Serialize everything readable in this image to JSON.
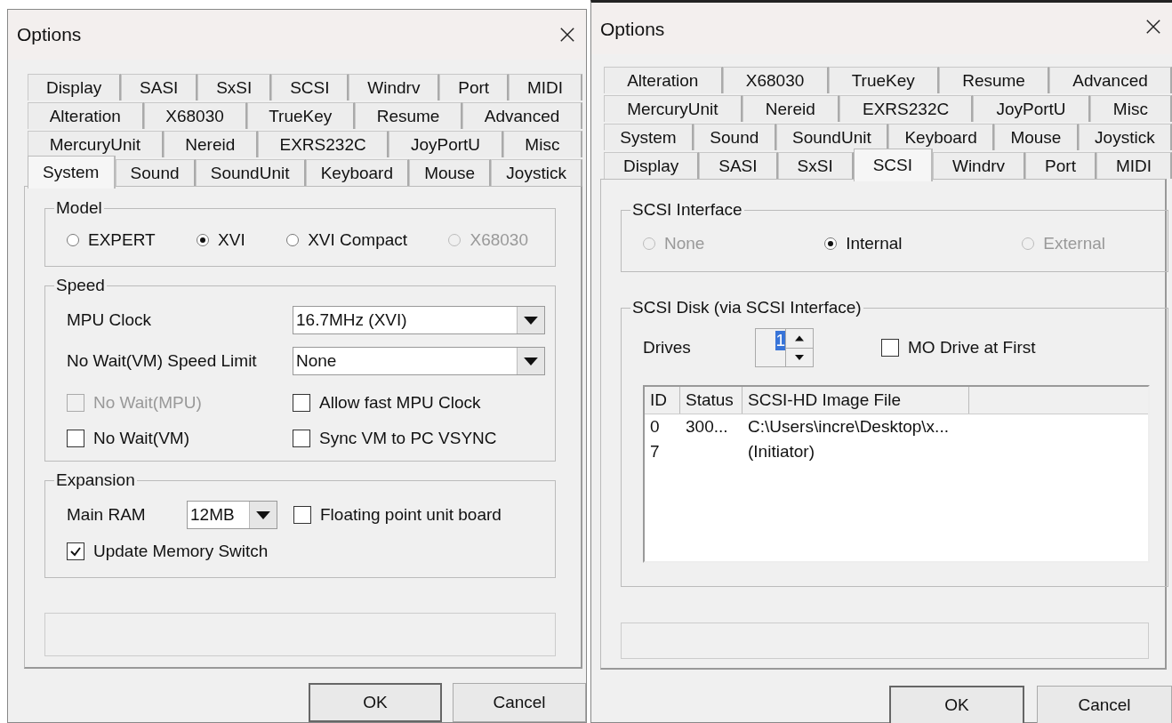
{
  "dialogs": [
    {
      "title": "Options",
      "tab_rows": [
        [
          {
            "label": "Display",
            "selected": false
          },
          {
            "label": "SASI",
            "selected": false
          },
          {
            "label": "SxSI",
            "selected": false
          },
          {
            "label": "SCSI",
            "selected": false
          },
          {
            "label": "Windrv",
            "selected": false
          },
          {
            "label": "Port",
            "selected": false
          },
          {
            "label": "MIDI",
            "selected": false
          }
        ],
        [
          {
            "label": "Alteration",
            "selected": false
          },
          {
            "label": "X68030",
            "selected": false
          },
          {
            "label": "TrueKey",
            "selected": false
          },
          {
            "label": "Resume",
            "selected": false
          },
          {
            "label": "Advanced",
            "selected": false
          }
        ],
        [
          {
            "label": "MercuryUnit",
            "selected": false
          },
          {
            "label": "Nereid",
            "selected": false
          },
          {
            "label": "EXRS232C",
            "selected": false
          },
          {
            "label": "JoyPortU",
            "selected": false
          },
          {
            "label": "Misc",
            "selected": false
          }
        ],
        [
          {
            "label": "System",
            "selected": true
          },
          {
            "label": "Sound",
            "selected": false
          },
          {
            "label": "SoundUnit",
            "selected": false
          },
          {
            "label": "Keyboard",
            "selected": false
          },
          {
            "label": "Mouse",
            "selected": false
          },
          {
            "label": "Joystick",
            "selected": false
          }
        ]
      ],
      "groups": [
        {
          "title": "Model",
          "controls": [
            {
              "kind": "radios",
              "options": [
                {
                  "label": "EXPERT",
                  "selected": false,
                  "disabled": false
                },
                {
                  "label": "XVI",
                  "selected": true,
                  "disabled": false
                },
                {
                  "label": "XVI Compact",
                  "selected": false,
                  "disabled": false
                },
                {
                  "label": "X68030",
                  "selected": false,
                  "disabled": true
                }
              ]
            }
          ]
        },
        {
          "title": "Speed",
          "controls": [
            {
              "kind": "select",
              "label": "MPU Clock",
              "value": "16.7MHz (XVI)"
            },
            {
              "kind": "select",
              "label": "No Wait(VM) Speed Limit",
              "value": "None"
            },
            {
              "kind": "check_grid",
              "checks": [
                {
                  "label": "No Wait(MPU)",
                  "checked": false,
                  "disabled": true
                },
                {
                  "label": "Allow fast MPU Clock",
                  "checked": false,
                  "disabled": false
                },
                {
                  "label": "No Wait(VM)",
                  "checked": false,
                  "disabled": false
                },
                {
                  "label": "Sync VM to PC VSYNC",
                  "checked": false,
                  "disabled": false
                }
              ]
            }
          ]
        },
        {
          "title": "Expansion",
          "controls": [
            {
              "kind": "ram",
              "label": "Main RAM",
              "value": "12MB",
              "check": {
                "label": "Floating point unit board",
                "checked": false
              }
            },
            {
              "kind": "check",
              "check": {
                "label": "Update Memory Switch",
                "checked": true
              }
            }
          ]
        }
      ],
      "buttons": [
        "OK",
        "Cancel"
      ]
    },
    {
      "title": "Options",
      "tab_rows": [
        [
          {
            "label": "Alteration",
            "selected": false
          },
          {
            "label": "X68030",
            "selected": false
          },
          {
            "label": "TrueKey",
            "selected": false
          },
          {
            "label": "Resume",
            "selected": false
          },
          {
            "label": "Advanced",
            "selected": false
          }
        ],
        [
          {
            "label": "MercuryUnit",
            "selected": false
          },
          {
            "label": "Nereid",
            "selected": false
          },
          {
            "label": "EXRS232C",
            "selected": false
          },
          {
            "label": "JoyPortU",
            "selected": false
          },
          {
            "label": "Misc",
            "selected": false
          }
        ],
        [
          {
            "label": "System",
            "selected": false
          },
          {
            "label": "Sound",
            "selected": false
          },
          {
            "label": "SoundUnit",
            "selected": false
          },
          {
            "label": "Keyboard",
            "selected": false
          },
          {
            "label": "Mouse",
            "selected": false
          },
          {
            "label": "Joystick",
            "selected": false
          }
        ],
        [
          {
            "label": "Display",
            "selected": false
          },
          {
            "label": "SASI",
            "selected": false
          },
          {
            "label": "SxSI",
            "selected": false
          },
          {
            "label": "SCSI",
            "selected": true
          },
          {
            "label": "Windrv",
            "selected": false
          },
          {
            "label": "Port",
            "selected": false
          },
          {
            "label": "MIDI",
            "selected": false
          }
        ]
      ],
      "groups": [
        {
          "title": "SCSI Interface",
          "controls": [
            {
              "kind": "radios",
              "options": [
                {
                  "label": "None",
                  "selected": false,
                  "disabled": true
                },
                {
                  "label": "Internal",
                  "selected": true,
                  "disabled": false
                },
                {
                  "label": "External",
                  "selected": false,
                  "disabled": true
                }
              ]
            }
          ]
        },
        {
          "title": "SCSI Disk (via SCSI Interface)",
          "controls": [
            {
              "kind": "spinner",
              "label": "Drives",
              "value": "1",
              "check": {
                "label": "MO Drive at First",
                "checked": false
              }
            },
            {
              "kind": "table",
              "columns": [
                "ID",
                "Status",
                "SCSI-HD Image File"
              ],
              "rows": [
                {
                  "id": "0",
                  "status": "300...",
                  "file": "C:\\Users\\incre\\Desktop\\x..."
                },
                {
                  "id": "7",
                  "file": "(Initiator)"
                }
              ]
            }
          ]
        }
      ],
      "buttons": [
        "OK",
        "Cancel"
      ]
    }
  ]
}
